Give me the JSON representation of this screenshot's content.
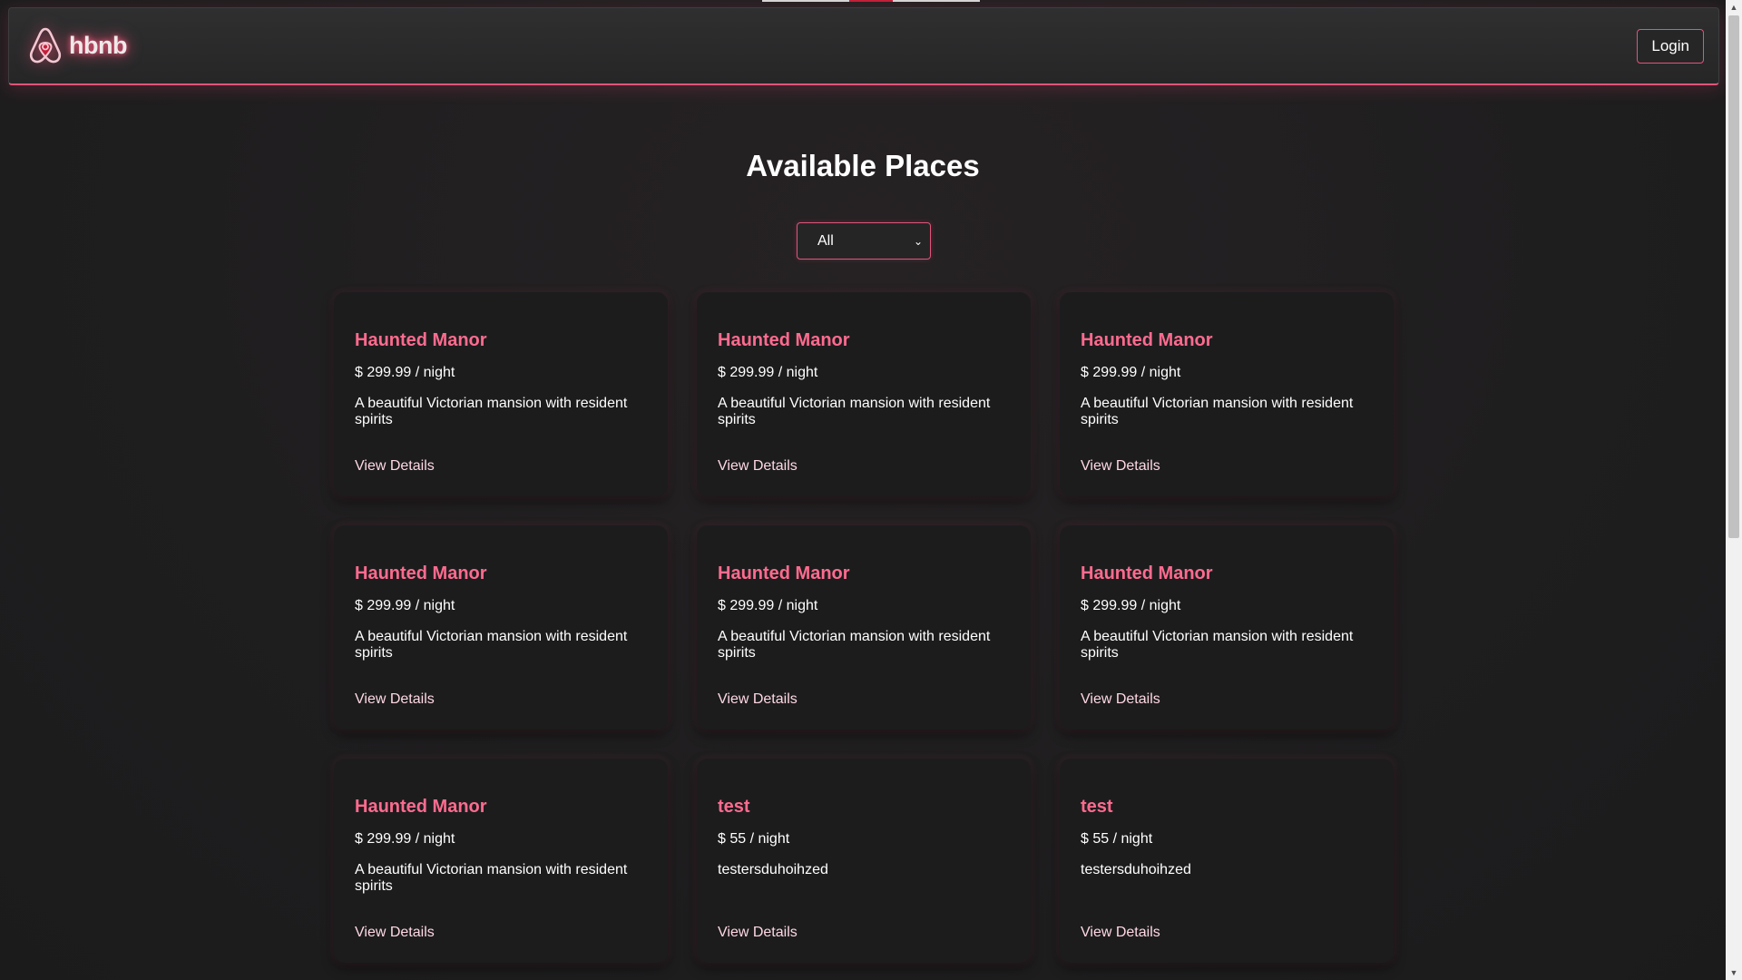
{
  "header": {
    "logo_text": "hbnb",
    "logo_icon": "airbnb-logo-icon",
    "login_label": "Login"
  },
  "main": {
    "title": "Available Places",
    "filter": {
      "selected": "All"
    },
    "view_details_label": "View Details",
    "places": [
      {
        "name": "Haunted Manor",
        "price": "$ 299.99 / night",
        "description": "A beautiful Victorian mansion with resident spirits"
      },
      {
        "name": "Haunted Manor",
        "price": "$ 299.99 / night",
        "description": "A beautiful Victorian mansion with resident spirits"
      },
      {
        "name": "Haunted Manor",
        "price": "$ 299.99 / night",
        "description": "A beautiful Victorian mansion with resident spirits"
      },
      {
        "name": "Haunted Manor",
        "price": "$ 299.99 / night",
        "description": "A beautiful Victorian mansion with resident spirits"
      },
      {
        "name": "Haunted Manor",
        "price": "$ 299.99 / night",
        "description": "A beautiful Victorian mansion with resident spirits"
      },
      {
        "name": "Haunted Manor",
        "price": "$ 299.99 / night",
        "description": "A beautiful Victorian mansion with resident spirits"
      },
      {
        "name": "Haunted Manor",
        "price": "$ 299.99 / night",
        "description": "A beautiful Victorian mansion with resident spirits"
      },
      {
        "name": "test",
        "price": "$ 55 / night",
        "description": "testersduhoihzed"
      },
      {
        "name": "test",
        "price": "$ 55 / night",
        "description": "testersduhoihzed"
      }
    ]
  },
  "colors": {
    "accent": "#e0557a",
    "title_pink": "#ff6b8f",
    "background": "#1e1e1f"
  }
}
